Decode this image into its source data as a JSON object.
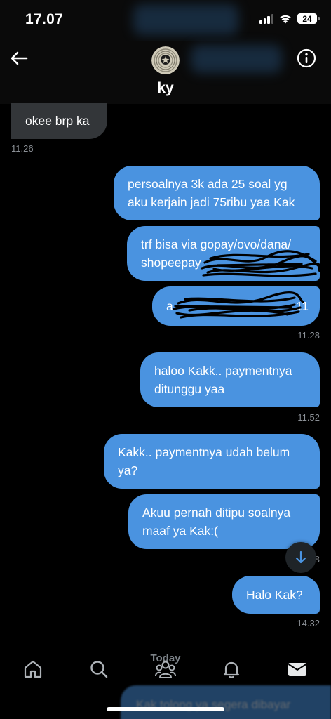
{
  "status_bar": {
    "time": "17.07",
    "battery": "24"
  },
  "header": {
    "contact_name": "ky"
  },
  "messages": [
    {
      "text": "okee brp ka",
      "direction": "received"
    },
    {
      "text": "persoalnya 3k ada 25 soal yg\naku kerjain jadi 75ribu yaa Kak",
      "direction": "sent"
    },
    {
      "text": "trf bisa via gopay/ovo/dana/\nshopeepay",
      "direction": "sent"
    },
    {
      "text": "a",
      "direction": "sent",
      "trailing_text": "11"
    },
    {
      "text": "haloo Kakk.. paymentnya\nditunggu yaa",
      "direction": "sent"
    },
    {
      "text": "Kakk.. paymentnya udah belum\nya?",
      "direction": "sent"
    },
    {
      "text": "Akuu pernah ditipu soalnya\nmaaf ya Kak:(",
      "direction": "sent"
    },
    {
      "text": "Halo Kak?",
      "direction": "sent"
    }
  ],
  "timestamps": [
    "11.26",
    "11.28",
    "11.52",
    "8",
    "14.32"
  ],
  "tab_bar": {
    "today_label": "Today",
    "items": [
      "home-icon",
      "search-icon",
      "communities-icon",
      "bell-icon",
      "mail-icon"
    ]
  },
  "composer_preview": "Kak tolong ya segera dibayar",
  "colors": {
    "sent_bubble": "#4a93e0",
    "received_bubble": "#333639",
    "background": "#000000",
    "timestamp": "#8b9096"
  }
}
